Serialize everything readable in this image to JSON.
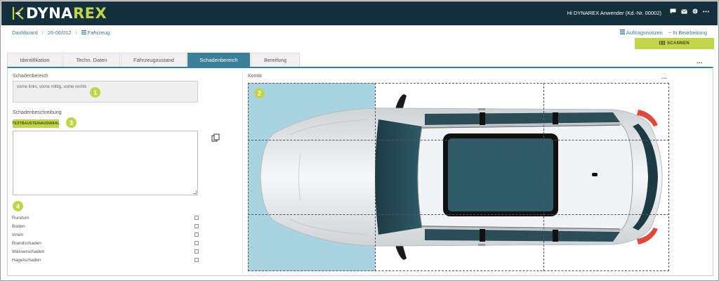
{
  "brand": {
    "prefix": "DYNA",
    "accent": "REX",
    "accent_color": "#c2d44a",
    "bar_color": "#14303c"
  },
  "header": {
    "greeting": "Hi DYNAREX Anwender (Kd.-Nr. 00002)",
    "icons": [
      "chat-icon",
      "mail-icon",
      "globe-icon",
      "more-icon"
    ]
  },
  "breadcrumb": {
    "items": [
      "Dashboard",
      "26-06/012"
    ],
    "current_icon": "list-icon",
    "current": "Fahrzeug"
  },
  "right_links": {
    "notes": "Auftragsnotizen",
    "status": "In Bearbeitung"
  },
  "scan_button": {
    "label": "SCANNEN",
    "icon": "barcode-icon"
  },
  "tabs": [
    "Identifikation",
    "Techn. Daten",
    "Fahrzeugzustand",
    "Schadenbereich",
    "Bereifung"
  ],
  "active_tab": "Schadenbereich",
  "tab_more": "...",
  "damage_area": {
    "label": "Schadenbereich",
    "value": "vorne links, vorne mittig, vorne rechts"
  },
  "damage_desc": {
    "label": "Schadenbeschreibung",
    "button": "TEXTBAUSTEINAUSWAHL",
    "value": ""
  },
  "badges": [
    "1",
    "2",
    "3",
    "4"
  ],
  "checkboxes": [
    {
      "label": "Rundum",
      "checked": false
    },
    {
      "label": "Boden",
      "checked": false
    },
    {
      "label": "Innen",
      "checked": false
    },
    {
      "label": "Brandschaden",
      "checked": false
    },
    {
      "label": "Wasserschaden",
      "checked": false
    },
    {
      "label": "Hagelschaden",
      "checked": false
    }
  ],
  "kombi": {
    "label": "Kombi",
    "menu": "...",
    "selected_zones": [
      "vorne links",
      "vorne mittig",
      "vorne rechts"
    ],
    "highlight_color": "#a8d4e2"
  }
}
